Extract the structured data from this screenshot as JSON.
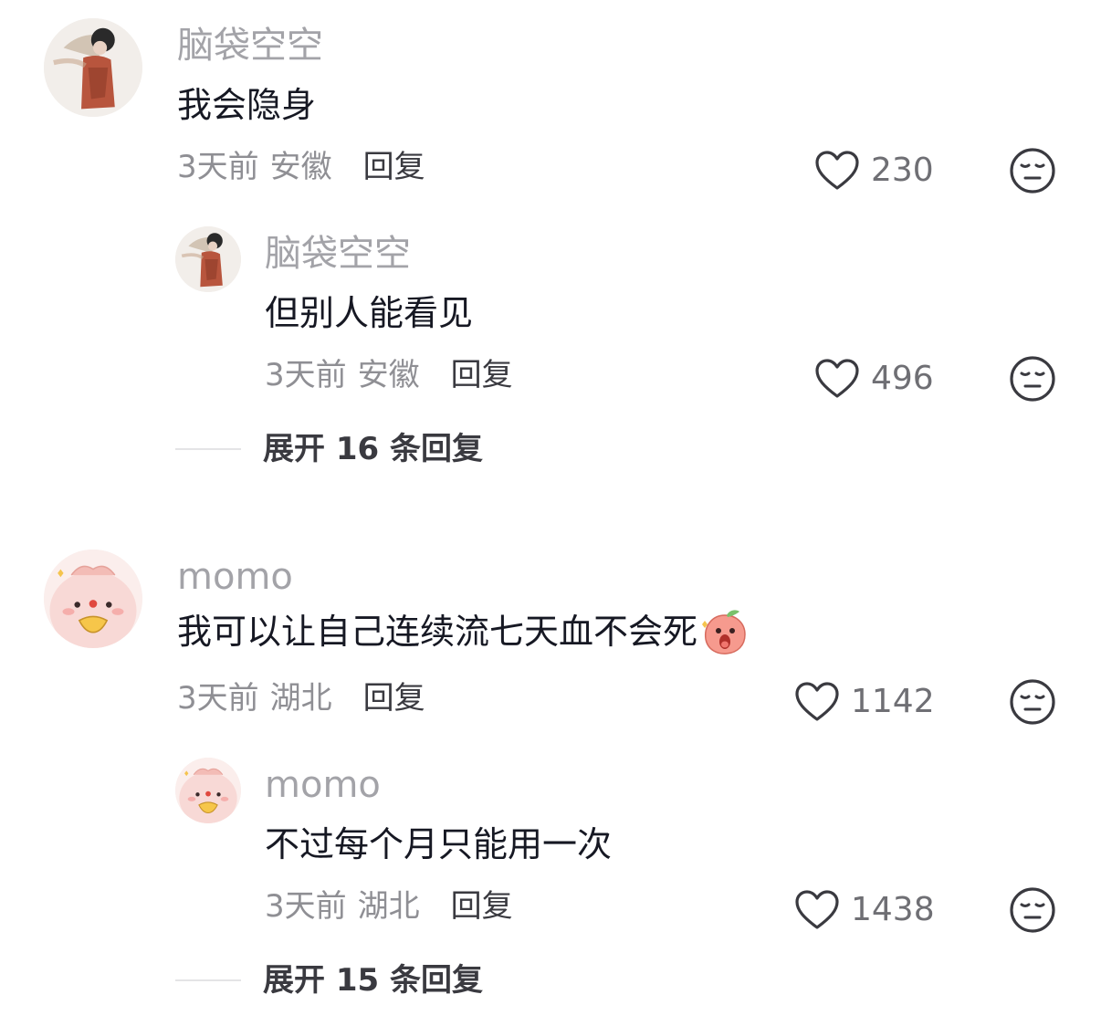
{
  "colors": {
    "username": "#a3a3a8",
    "text": "#161823",
    "meta": "#8f8f94",
    "reply": "#3a3a40",
    "line": "#e4e4e6"
  },
  "comments": [
    {
      "username": "脑袋空空",
      "avatar_icon": "avatar-woman-icon",
      "text": "我会隐身",
      "time": "3天前",
      "location": "安徽",
      "reply_label": "回复",
      "likes": "230",
      "replies": [
        {
          "username": "脑袋空空",
          "avatar_icon": "avatar-woman-icon",
          "text": "但别人能看见",
          "time": "3天前",
          "location": "安徽",
          "reply_label": "回复",
          "likes": "496"
        }
      ],
      "expand_label": "展开 16 条回复"
    },
    {
      "username": "momo",
      "avatar_icon": "avatar-pink-cartoon-icon",
      "text": "我可以让自己连续流七天血不会死",
      "emoji": "shocked-peach-emoji",
      "time": "3天前",
      "location": "湖北",
      "reply_label": "回复",
      "likes": "1142",
      "replies": [
        {
          "username": "momo",
          "avatar_icon": "avatar-pink-cartoon-icon",
          "text": "不过每个月只能用一次",
          "time": "3天前",
          "location": "湖北",
          "reply_label": "回复",
          "likes": "1438"
        }
      ],
      "expand_label": "展开 15 条回复"
    }
  ]
}
